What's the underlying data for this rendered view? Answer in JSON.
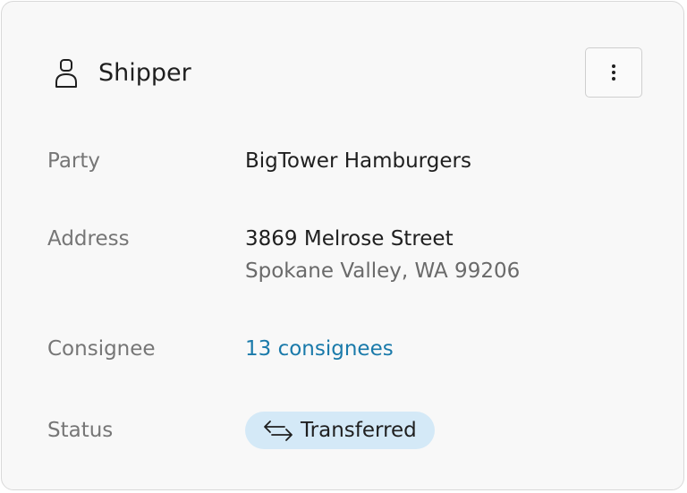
{
  "header": {
    "title": "Shipper",
    "icon": "person-icon",
    "menu_icon": "more-vertical-icon"
  },
  "fields": {
    "party": {
      "label": "Party",
      "value": "BigTower Hamburgers"
    },
    "address": {
      "label": "Address",
      "line1": "3869 Melrose Street",
      "line2": "Spokane Valley, WA 99206"
    },
    "consignee": {
      "label": "Consignee",
      "link_text": "13 consignees"
    },
    "status": {
      "label": "Status",
      "badge_text": "Transferred",
      "badge_icon": "transfer-arrows-icon"
    }
  },
  "colors": {
    "card_background": "#f8f8f8",
    "card_border": "#d9d9d9",
    "label_text": "#767676",
    "value_text": "#1f1f1f",
    "link": "#1a7aaa",
    "badge_background": "#d4e9f7"
  }
}
